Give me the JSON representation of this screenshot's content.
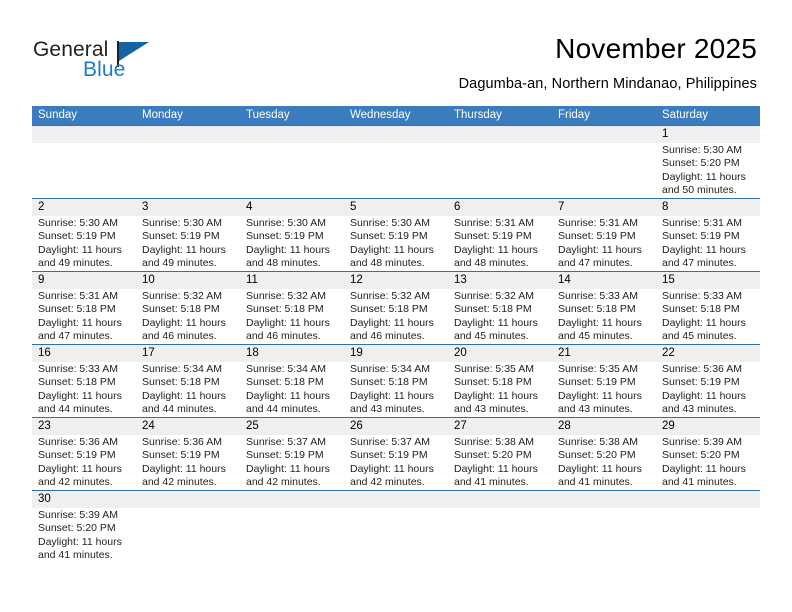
{
  "brand": {
    "name_top": "General",
    "name_bottom": "Blue",
    "accent_color": "#1d7cc4",
    "flag_color": "#1264a5"
  },
  "header": {
    "title": "November 2025",
    "subtitle": "Dagumba-an, Northern Mindanao, Philippines"
  },
  "calendar": {
    "header_bg": "#3a7cbe",
    "row_border": "#2e72ac",
    "daynum_band": "#efefef",
    "weekdays": [
      "Sunday",
      "Monday",
      "Tuesday",
      "Wednesday",
      "Thursday",
      "Friday",
      "Saturday"
    ],
    "weeks": [
      [
        {
          "day": "",
          "info": ""
        },
        {
          "day": "",
          "info": ""
        },
        {
          "day": "",
          "info": ""
        },
        {
          "day": "",
          "info": ""
        },
        {
          "day": "",
          "info": ""
        },
        {
          "day": "",
          "info": ""
        },
        {
          "day": "1",
          "info": "Sunrise: 5:30 AM\nSunset: 5:20 PM\nDaylight: 11 hours\nand 50 minutes."
        }
      ],
      [
        {
          "day": "2",
          "info": "Sunrise: 5:30 AM\nSunset: 5:19 PM\nDaylight: 11 hours\nand 49 minutes."
        },
        {
          "day": "3",
          "info": "Sunrise: 5:30 AM\nSunset: 5:19 PM\nDaylight: 11 hours\nand 49 minutes."
        },
        {
          "day": "4",
          "info": "Sunrise: 5:30 AM\nSunset: 5:19 PM\nDaylight: 11 hours\nand 48 minutes."
        },
        {
          "day": "5",
          "info": "Sunrise: 5:30 AM\nSunset: 5:19 PM\nDaylight: 11 hours\nand 48 minutes."
        },
        {
          "day": "6",
          "info": "Sunrise: 5:31 AM\nSunset: 5:19 PM\nDaylight: 11 hours\nand 48 minutes."
        },
        {
          "day": "7",
          "info": "Sunrise: 5:31 AM\nSunset: 5:19 PM\nDaylight: 11 hours\nand 47 minutes."
        },
        {
          "day": "8",
          "info": "Sunrise: 5:31 AM\nSunset: 5:19 PM\nDaylight: 11 hours\nand 47 minutes."
        }
      ],
      [
        {
          "day": "9",
          "info": "Sunrise: 5:31 AM\nSunset: 5:18 PM\nDaylight: 11 hours\nand 47 minutes."
        },
        {
          "day": "10",
          "info": "Sunrise: 5:32 AM\nSunset: 5:18 PM\nDaylight: 11 hours\nand 46 minutes."
        },
        {
          "day": "11",
          "info": "Sunrise: 5:32 AM\nSunset: 5:18 PM\nDaylight: 11 hours\nand 46 minutes."
        },
        {
          "day": "12",
          "info": "Sunrise: 5:32 AM\nSunset: 5:18 PM\nDaylight: 11 hours\nand 46 minutes."
        },
        {
          "day": "13",
          "info": "Sunrise: 5:32 AM\nSunset: 5:18 PM\nDaylight: 11 hours\nand 45 minutes."
        },
        {
          "day": "14",
          "info": "Sunrise: 5:33 AM\nSunset: 5:18 PM\nDaylight: 11 hours\nand 45 minutes."
        },
        {
          "day": "15",
          "info": "Sunrise: 5:33 AM\nSunset: 5:18 PM\nDaylight: 11 hours\nand 45 minutes."
        }
      ],
      [
        {
          "day": "16",
          "info": "Sunrise: 5:33 AM\nSunset: 5:18 PM\nDaylight: 11 hours\nand 44 minutes."
        },
        {
          "day": "17",
          "info": "Sunrise: 5:34 AM\nSunset: 5:18 PM\nDaylight: 11 hours\nand 44 minutes."
        },
        {
          "day": "18",
          "info": "Sunrise: 5:34 AM\nSunset: 5:18 PM\nDaylight: 11 hours\nand 44 minutes."
        },
        {
          "day": "19",
          "info": "Sunrise: 5:34 AM\nSunset: 5:18 PM\nDaylight: 11 hours\nand 43 minutes."
        },
        {
          "day": "20",
          "info": "Sunrise: 5:35 AM\nSunset: 5:18 PM\nDaylight: 11 hours\nand 43 minutes."
        },
        {
          "day": "21",
          "info": "Sunrise: 5:35 AM\nSunset: 5:19 PM\nDaylight: 11 hours\nand 43 minutes."
        },
        {
          "day": "22",
          "info": "Sunrise: 5:36 AM\nSunset: 5:19 PM\nDaylight: 11 hours\nand 43 minutes."
        }
      ],
      [
        {
          "day": "23",
          "info": "Sunrise: 5:36 AM\nSunset: 5:19 PM\nDaylight: 11 hours\nand 42 minutes."
        },
        {
          "day": "24",
          "info": "Sunrise: 5:36 AM\nSunset: 5:19 PM\nDaylight: 11 hours\nand 42 minutes."
        },
        {
          "day": "25",
          "info": "Sunrise: 5:37 AM\nSunset: 5:19 PM\nDaylight: 11 hours\nand 42 minutes."
        },
        {
          "day": "26",
          "info": "Sunrise: 5:37 AM\nSunset: 5:19 PM\nDaylight: 11 hours\nand 42 minutes."
        },
        {
          "day": "27",
          "info": "Sunrise: 5:38 AM\nSunset: 5:20 PM\nDaylight: 11 hours\nand 41 minutes."
        },
        {
          "day": "28",
          "info": "Sunrise: 5:38 AM\nSunset: 5:20 PM\nDaylight: 11 hours\nand 41 minutes."
        },
        {
          "day": "29",
          "info": "Sunrise: 5:39 AM\nSunset: 5:20 PM\nDaylight: 11 hours\nand 41 minutes."
        }
      ],
      [
        {
          "day": "30",
          "info": "Sunrise: 5:39 AM\nSunset: 5:20 PM\nDaylight: 11 hours\nand 41 minutes."
        },
        {
          "day": "",
          "info": ""
        },
        {
          "day": "",
          "info": ""
        },
        {
          "day": "",
          "info": ""
        },
        {
          "day": "",
          "info": ""
        },
        {
          "day": "",
          "info": ""
        },
        {
          "day": "",
          "info": ""
        }
      ]
    ]
  }
}
